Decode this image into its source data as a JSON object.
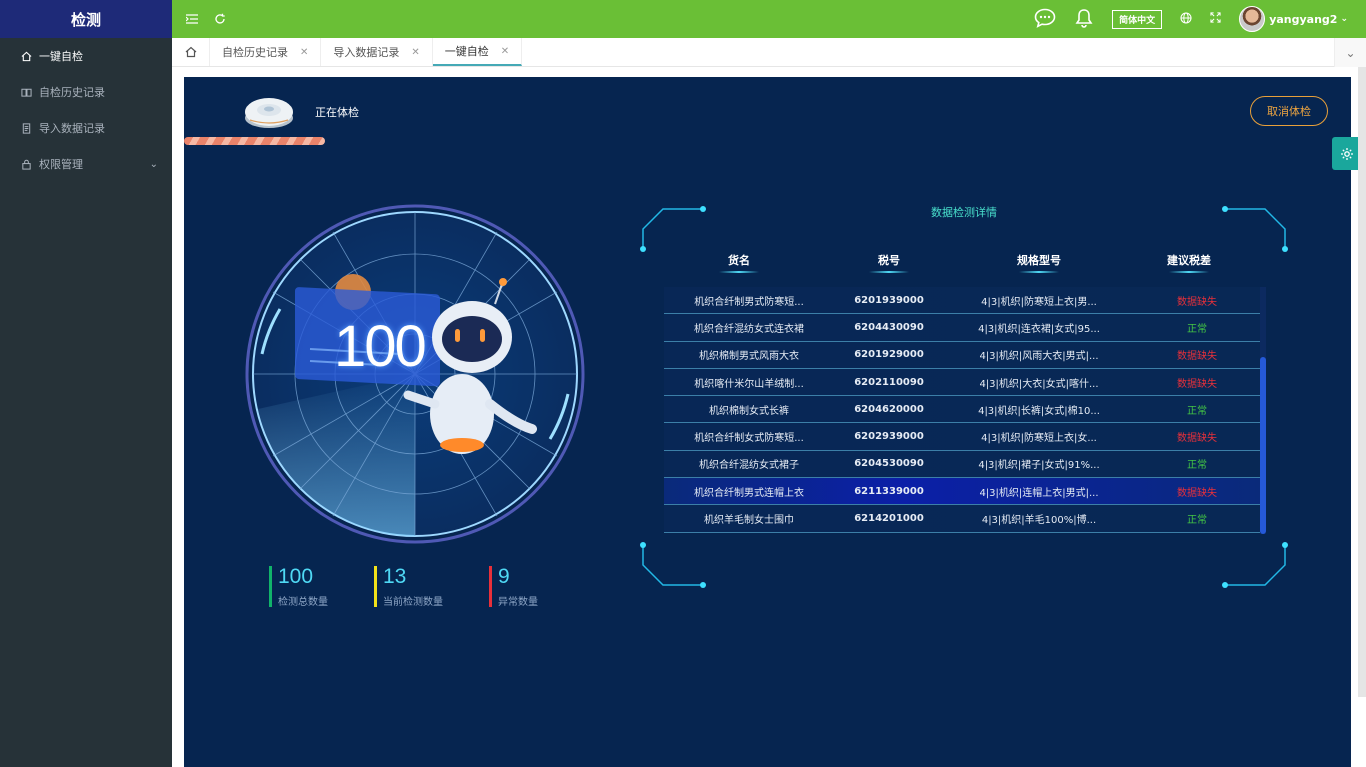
{
  "app": {
    "title": "检测"
  },
  "sidebar": {
    "items": [
      {
        "label": "一键自检",
        "icon": "home-icon"
      },
      {
        "label": "自检历史记录",
        "icon": "book-icon"
      },
      {
        "label": "导入数据记录",
        "icon": "document-icon"
      },
      {
        "label": "权限管理",
        "icon": "lock-icon"
      }
    ]
  },
  "header": {
    "language": "简体中文",
    "username": "yangyang2"
  },
  "tabs": [
    {
      "label": "自检历史记录"
    },
    {
      "label": "导入数据记录"
    },
    {
      "label": "一键自检"
    }
  ],
  "check": {
    "status": "正在体检",
    "cancel_label": "取消体检",
    "score": "100",
    "progress_percent": 20
  },
  "stats": [
    {
      "value": "100",
      "label": "检测总数量",
      "color": "#11b36a"
    },
    {
      "value": "13",
      "label": "当前检测数量",
      "color": "#f2e21a"
    },
    {
      "value": "9",
      "label": "异常数量",
      "color": "#e8303a"
    }
  ],
  "detail": {
    "title": "数据检测详情",
    "columns": [
      "货名",
      "税号",
      "规格型号",
      "建议税差"
    ],
    "rows": [
      {
        "name": "机织合纤制男式防寒短...",
        "code": "6201939000",
        "spec": "4|3|机织|防寒短上衣|男...",
        "status": "数据缺失"
      },
      {
        "name": "机织合纤混纺女式连衣裙",
        "code": "6204430090",
        "spec": "4|3|机织|连衣裙|女式|95...",
        "status": "正常"
      },
      {
        "name": "机织棉制男式风雨大衣",
        "code": "6201929000",
        "spec": "4|3|机织|风雨大衣|男式|...",
        "status": "数据缺失"
      },
      {
        "name": "机织喀什米尔山羊绒制...",
        "code": "6202110090",
        "spec": "4|3|机织|大衣|女式|喀什...",
        "status": "数据缺失"
      },
      {
        "name": "机织棉制女式长裤",
        "code": "6204620000",
        "spec": "4|3|机织|长裤|女式|棉10...",
        "status": "正常"
      },
      {
        "name": "机织合纤制女式防寒短...",
        "code": "6202939000",
        "spec": "4|3|机织|防寒短上衣|女...",
        "status": "数据缺失"
      },
      {
        "name": "机织合纤混纺女式裙子",
        "code": "6204530090",
        "spec": "4|3|机织|裙子|女式|91%...",
        "status": "正常"
      },
      {
        "name": "机织合纤制男式连帽上衣",
        "code": "6211339000",
        "spec": "4|3|机织|连帽上衣|男式|...",
        "status": "数据缺失"
      },
      {
        "name": "机织羊毛制女士围巾",
        "code": "6214201000",
        "spec": "4|3|机织|羊毛100%|博...",
        "status": "正常"
      }
    ]
  }
}
